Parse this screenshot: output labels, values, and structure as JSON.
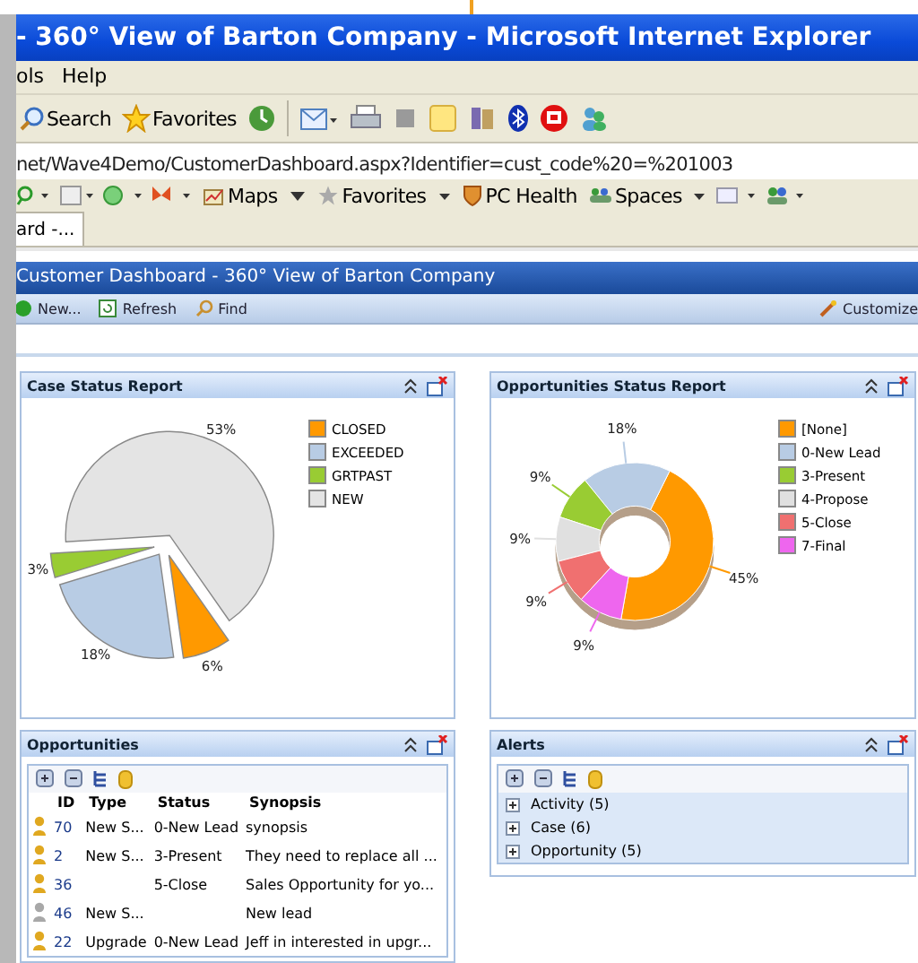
{
  "window": {
    "title": "- 360° View of Barton Company - Microsoft Internet Explorer"
  },
  "menu": [
    "ols",
    "Help"
  ],
  "toolbar": {
    "search": "Search",
    "favorites": "Favorites"
  },
  "address": {
    "value": "net/Wave4Demo/CustomerDashboard.aspx?Identifier=cust_code%20=%201003"
  },
  "links_bar": [
    "Maps",
    "Favorites",
    "PC Health",
    "Spaces"
  ],
  "tab": {
    "label": "ard -..."
  },
  "dashboard": {
    "title": "Customer Dashboard - 360° View of Barton Company",
    "actions": [
      "New...",
      "Refresh",
      "Find"
    ],
    "customize": "Customize"
  },
  "case_status": {
    "title": "Case Status Report",
    "chart_data": {
      "type": "pie",
      "categories": [
        "CLOSED",
        "EXCEEDED",
        "GRTPAST",
        "NEW"
      ],
      "values": [
        6,
        18,
        3,
        53
      ],
      "colors": [
        "#ff9900",
        "#b8cce4",
        "#99cc33",
        "#e4e4e4"
      ],
      "data_labels": true,
      "value_labels": [
        "6%",
        "18%",
        "3%",
        "53%"
      ],
      "legend": "right"
    }
  },
  "opportunities_status": {
    "title": "Opportunities Status Report",
    "chart_data": {
      "type": "donut",
      "categories": [
        "[None]",
        "0-New Lead",
        "3-Present",
        "4-Propose",
        "5-Close",
        "7-Final"
      ],
      "values": [
        45,
        18,
        9,
        9,
        9,
        9
      ],
      "colors": [
        "#ff9900",
        "#b8cce4",
        "#99cc33",
        "#e0e0e0",
        "#f07070",
        "#ee66ee"
      ],
      "data_labels": true,
      "value_labels": [
        "45%",
        "18%",
        "9%",
        "9%",
        "9%",
        "9%"
      ],
      "legend": "right"
    }
  },
  "opportunities": {
    "title": "Opportunities",
    "columns": [
      "ID",
      "Type",
      "Status",
      "Synopsis"
    ],
    "rows": [
      {
        "id": "70",
        "type": "New S...",
        "status": "0-New Lead",
        "synopsis": "synopsis",
        "color": "#e0a820"
      },
      {
        "id": "2",
        "type": "New S...",
        "status": "3-Present",
        "synopsis": "They need to replace all ...",
        "color": "#e0a820"
      },
      {
        "id": "36",
        "type": "",
        "status": "5-Close",
        "synopsis": "Sales Opportunity for yo...",
        "color": "#e0a820"
      },
      {
        "id": "46",
        "type": "New S...",
        "status": "",
        "synopsis": "New lead",
        "color": "#a8a8a8"
      },
      {
        "id": "22",
        "type": "Upgrade",
        "status": "0-New Lead",
        "synopsis": "Jeff in interested in upgr...",
        "color": "#e0a820"
      }
    ]
  },
  "alerts": {
    "title": "Alerts",
    "items": [
      {
        "label": "Activity (5)",
        "expanded": false
      },
      {
        "label": "Case (6)",
        "expanded": false
      },
      {
        "label": "Opportunity (5)",
        "expanded": false
      }
    ]
  }
}
